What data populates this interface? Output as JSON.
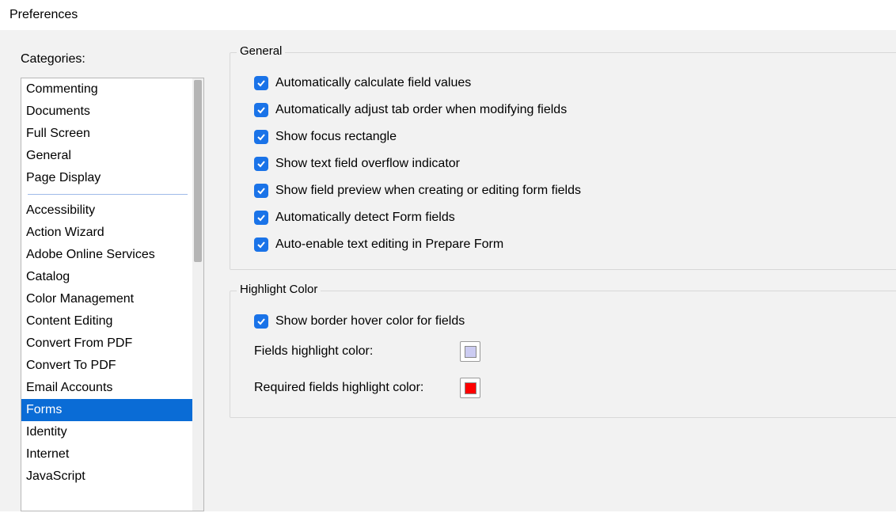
{
  "window": {
    "title": "Preferences"
  },
  "sidebar": {
    "heading": "Categories:",
    "topItems": [
      "Commenting",
      "Documents",
      "Full Screen",
      "General",
      "Page Display"
    ],
    "bottomItems": [
      "Accessibility",
      "Action Wizard",
      "Adobe Online Services",
      "Catalog",
      "Color Management",
      "Content Editing",
      "Convert From PDF",
      "Convert To PDF",
      "Email Accounts",
      "Forms",
      "Identity",
      "Internet",
      "JavaScript"
    ],
    "selected": "Forms"
  },
  "groups": {
    "general": {
      "title": "General",
      "options": [
        {
          "label": "Automatically calculate field values",
          "checked": true
        },
        {
          "label": "Automatically adjust tab order when modifying fields",
          "checked": true
        },
        {
          "label": "Show focus rectangle",
          "checked": true
        },
        {
          "label": "Show text field overflow indicator",
          "checked": true
        },
        {
          "label": "Show field preview when creating or editing form fields",
          "checked": true
        },
        {
          "label": "Automatically detect Form fields",
          "checked": true
        },
        {
          "label": "Auto-enable text editing in Prepare Form",
          "checked": true
        }
      ]
    },
    "highlight": {
      "title": "Highlight Color",
      "showBorder": {
        "label": "Show border hover color for fields",
        "checked": true
      },
      "fieldsLabel": "Fields highlight color:",
      "fieldsColor": "#ccccf2",
      "requiredLabel": "Required fields highlight color:",
      "requiredColor": "#ff0000"
    }
  }
}
